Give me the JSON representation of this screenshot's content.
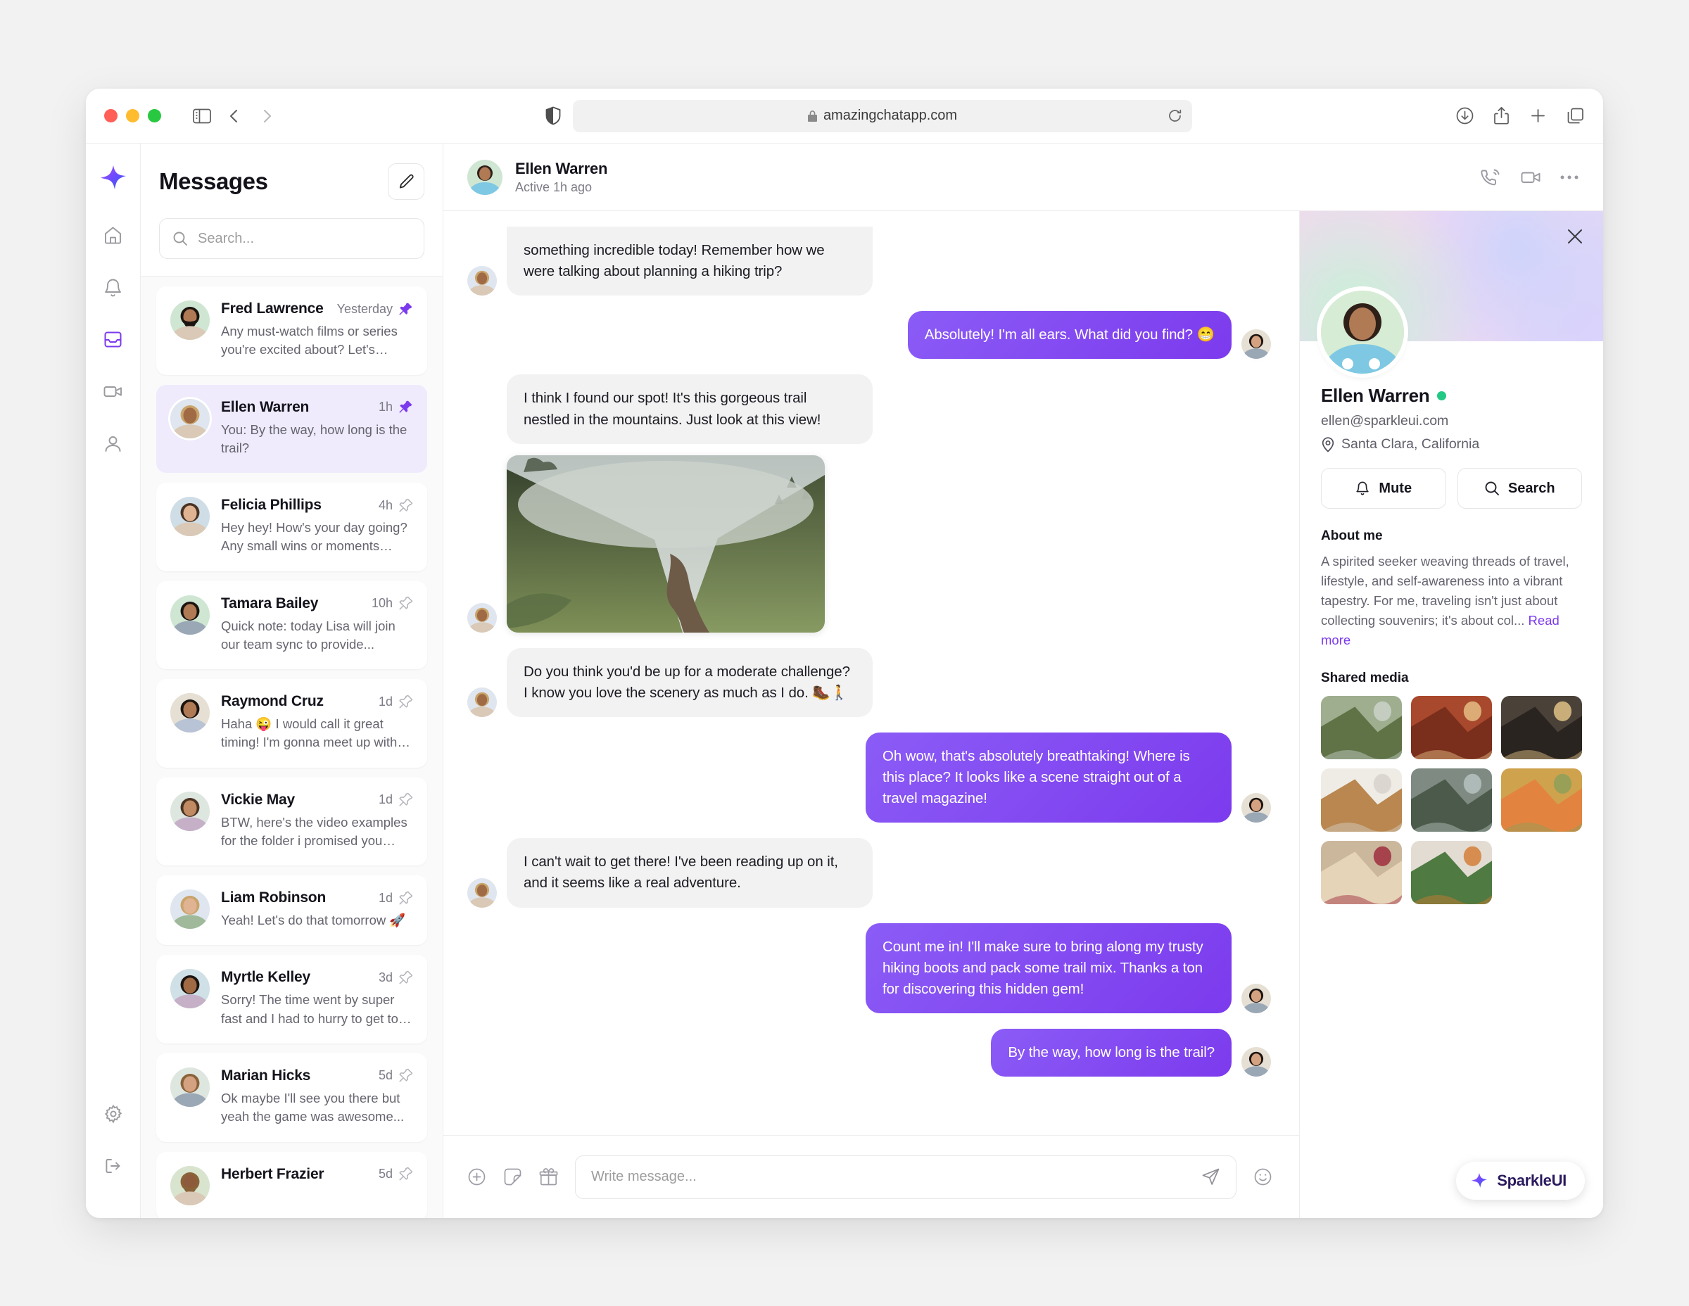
{
  "browser": {
    "url": "amazingchatapp.com",
    "lock_icon": "lock-icon",
    "shield_icon": "shield-icon",
    "back_icon": "chevron-left-icon",
    "forward_icon": "chevron-right-icon",
    "sidebar_icon": "sidebar-toggle-icon",
    "downloads_icon": "downloads-icon",
    "share_icon": "share-icon",
    "newtab_icon": "plus-icon",
    "tabs_icon": "tab-overview-icon",
    "reload_icon": "reload-icon"
  },
  "rail": {
    "logo": "sparkle-logo-icon",
    "items": [
      {
        "icon": "home-icon",
        "name": "home",
        "active": false
      },
      {
        "icon": "bell-icon",
        "name": "notifications",
        "active": false
      },
      {
        "icon": "inbox-icon",
        "name": "messages",
        "active": true
      },
      {
        "icon": "video-icon",
        "name": "calls",
        "active": false
      },
      {
        "icon": "user-icon",
        "name": "contacts",
        "active": false
      }
    ],
    "bottom": [
      {
        "icon": "gear-icon",
        "name": "settings"
      },
      {
        "icon": "logout-icon",
        "name": "logout"
      }
    ]
  },
  "sidebar": {
    "title": "Messages",
    "compose_icon": "compose-pencil-icon",
    "search_placeholder": "Search...",
    "search_value": "",
    "search_icon": "search-icon",
    "conversations": [
      {
        "name": "Fred Lawrence",
        "time": "Yesterday",
        "preview": "Any must-watch films or series you're excited about? Let's plan...",
        "pinned": true,
        "active": false
      },
      {
        "name": "Ellen Warren",
        "time": "1h",
        "preview": "You: By the way, how long is the trail?",
        "pinned": true,
        "active": true
      },
      {
        "name": "Felicia Phillips",
        "time": "4h",
        "preview": "Hey hey! How's your day going? Any small wins or moments that...",
        "pinned": false,
        "active": false
      },
      {
        "name": "Tamara Bailey",
        "time": "10h",
        "preview": "Quick note: today Lisa will join our team sync to provide...",
        "pinned": false,
        "active": false
      },
      {
        "name": "Raymond Cruz",
        "time": "1d",
        "preview": "Haha 😜 I would call it great timing! I'm gonna meet up with some of...",
        "pinned": false,
        "active": false
      },
      {
        "name": "Vickie May",
        "time": "1d",
        "preview": "BTW, here's the video examples for the folder i promised you yester...",
        "pinned": false,
        "active": false
      },
      {
        "name": "Liam Robinson",
        "time": "1d",
        "preview": "Yeah! Let's do that tomorrow 🚀",
        "pinned": false,
        "active": false
      },
      {
        "name": "Myrtle Kelley",
        "time": "3d",
        "preview": "Sorry! The time went by super fast and I had to hurry to get to the...",
        "pinned": false,
        "active": false
      },
      {
        "name": "Marian Hicks",
        "time": "5d",
        "preview": "Ok maybe I'll see you there but yeah the game was awesome...",
        "pinned": false,
        "active": false
      },
      {
        "name": "Herbert Frazier",
        "time": "5d",
        "preview": "",
        "pinned": false,
        "active": false
      }
    ]
  },
  "chat": {
    "header": {
      "name": "Ellen Warren",
      "status": "Active 1h ago",
      "call_icon": "phone-call-icon",
      "video_icon": "video-camera-icon",
      "more_icon": "more-horizontal-icon"
    },
    "messages": [
      {
        "side": "in",
        "text": "something incredible today! Remember how we were talking about planning a hiking trip?",
        "clipped": true
      },
      {
        "side": "out",
        "text": "Absolutely! I'm all ears. What did you find? 😁"
      },
      {
        "side": "in",
        "text": "I think I found our spot! It's this gorgeous trail nestled in the mountains. Just look at this view!",
        "photo": "misty-mountain-trail"
      },
      {
        "side": "in",
        "text": "Do you think you'd be up for a moderate challenge? I know you love the scenery as much as I do. 🥾🚶"
      },
      {
        "side": "out",
        "text": "Oh wow, that's absolutely breathtaking! Where is this place? It looks like a scene straight out of a travel magazine!"
      },
      {
        "side": "in",
        "text": "I can't wait to get there! I've been reading up on it, and it seems like a real adventure."
      },
      {
        "side": "out",
        "text": "Count me in! I'll make sure to bring along my trusty hiking boots and pack some trail mix. Thanks a ton for discovering this hidden gem!"
      },
      {
        "side": "out",
        "text": "By the way, how long is the trail?"
      }
    ],
    "composer": {
      "placeholder": "Write message...",
      "value": "",
      "plus_icon": "plus-circle-icon",
      "sticker_icon": "sticker-icon",
      "gift_icon": "gift-icon",
      "send_icon": "send-icon",
      "emoji_icon": "emoji-smiley-icon"
    }
  },
  "profile": {
    "close_icon": "close-icon",
    "name": "Ellen Warren",
    "online": true,
    "email": "ellen@sparkleui.com",
    "location": "Santa Clara, California",
    "location_icon": "map-pin-icon",
    "actions": [
      {
        "label": "Mute",
        "icon": "bell-icon"
      },
      {
        "label": "Search",
        "icon": "search-icon"
      }
    ],
    "about_title": "About me",
    "about_text": "A spirited seeker weaving threads of travel, lifestyle, and self-awareness into a vibrant tapestry. For me, traveling isn't just about collecting souvenirs; it's about col...",
    "read_more": "Read more",
    "media_title": "Shared media",
    "media": [
      "misty-green-trail",
      "red-rock-canyon",
      "candles-interior",
      "living-room-chair",
      "rocky-peaks",
      "salmon-dish",
      "pancakes-berries",
      "plant-filled-room"
    ]
  },
  "brand": {
    "label": "SparkleUI",
    "icon": "sparkle-logo-icon"
  },
  "colors": {
    "accent": "#7c3aed",
    "bubble_out": "#8b5cf6",
    "bubble_in": "#f2f2f3",
    "online": "#22c883",
    "active_conv": "#efeafc"
  }
}
